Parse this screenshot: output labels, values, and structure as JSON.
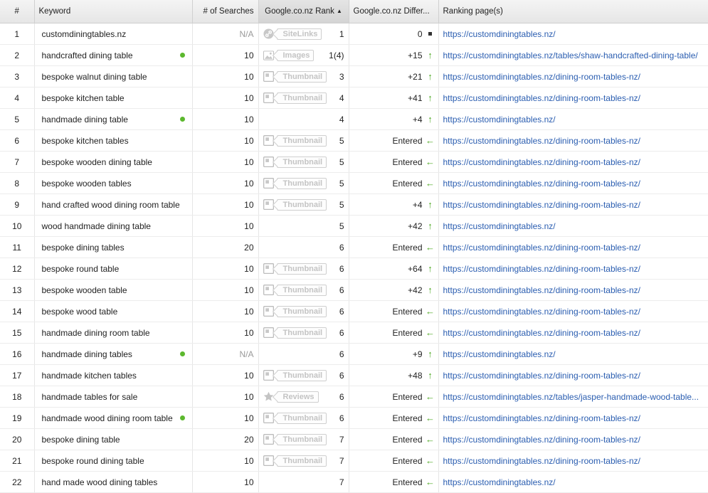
{
  "colors": {
    "accent_green": "#5cb82e",
    "link_blue": "#2a5db0",
    "tag_gray": "#c4c4c4"
  },
  "icons": {
    "sitelinks": "link-icon",
    "images": "image-icon",
    "thumbnail": "thumbnail-icon",
    "reviews": "star-icon",
    "up": "arrow-up-icon",
    "same": "no-change-icon",
    "entered": "arrow-left-icon",
    "sort": "sort-asc-icon"
  },
  "header": {
    "num": "#",
    "keyword": "Keyword",
    "searches": "# of Searches",
    "rank": "Google.co.nz Rank",
    "diff": "Google.co.nz Differ...",
    "page": "Ranking page(s)"
  },
  "rows": [
    {
      "num": "1",
      "keyword": "customdiningtables.nz",
      "dot": false,
      "searches": "N/A",
      "feature": "sitelinks",
      "feature_label": "SiteLinks",
      "rank": "1",
      "diff": "0",
      "diff_type": "same",
      "url": "https://customdiningtables.nz/"
    },
    {
      "num": "2",
      "keyword": "handcrafted dining table",
      "dot": true,
      "searches": "10",
      "feature": "images",
      "feature_label": "Images",
      "rank": "1(4)",
      "diff": "+15",
      "diff_type": "up",
      "url": "https://customdiningtables.nz/tables/shaw-handcrafted-dining-table/"
    },
    {
      "num": "3",
      "keyword": "bespoke walnut dining table",
      "dot": false,
      "searches": "10",
      "feature": "thumbnail",
      "feature_label": "Thumbnail",
      "rank": "3",
      "diff": "+21",
      "diff_type": "up",
      "url": "https://customdiningtables.nz/dining-room-tables-nz/"
    },
    {
      "num": "4",
      "keyword": "bespoke kitchen table",
      "dot": false,
      "searches": "10",
      "feature": "thumbnail",
      "feature_label": "Thumbnail",
      "rank": "4",
      "diff": "+41",
      "diff_type": "up",
      "url": "https://customdiningtables.nz/dining-room-tables-nz/"
    },
    {
      "num": "5",
      "keyword": "handmade dining table",
      "dot": true,
      "searches": "10",
      "feature": "",
      "feature_label": "",
      "rank": "4",
      "diff": "+4",
      "diff_type": "up",
      "url": "https://customdiningtables.nz/"
    },
    {
      "num": "6",
      "keyword": "bespoke kitchen tables",
      "dot": false,
      "searches": "10",
      "feature": "thumbnail",
      "feature_label": "Thumbnail",
      "rank": "5",
      "diff": "Entered",
      "diff_type": "entered",
      "url": "https://customdiningtables.nz/dining-room-tables-nz/"
    },
    {
      "num": "7",
      "keyword": "bespoke wooden dining table",
      "dot": false,
      "searches": "10",
      "feature": "thumbnail",
      "feature_label": "Thumbnail",
      "rank": "5",
      "diff": "Entered",
      "diff_type": "entered",
      "url": "https://customdiningtables.nz/dining-room-tables-nz/"
    },
    {
      "num": "8",
      "keyword": "bespoke wooden tables",
      "dot": false,
      "searches": "10",
      "feature": "thumbnail",
      "feature_label": "Thumbnail",
      "rank": "5",
      "diff": "Entered",
      "diff_type": "entered",
      "url": "https://customdiningtables.nz/dining-room-tables-nz/"
    },
    {
      "num": "9",
      "keyword": "hand crafted wood dining room table",
      "dot": false,
      "searches": "10",
      "feature": "thumbnail",
      "feature_label": "Thumbnail",
      "rank": "5",
      "diff": "+4",
      "diff_type": "up",
      "url": "https://customdiningtables.nz/dining-room-tables-nz/"
    },
    {
      "num": "10",
      "keyword": "wood handmade dining table",
      "dot": false,
      "searches": "10",
      "feature": "",
      "feature_label": "",
      "rank": "5",
      "diff": "+42",
      "diff_type": "up",
      "url": "https://customdiningtables.nz/"
    },
    {
      "num": "11",
      "keyword": "bespoke dining tables",
      "dot": false,
      "searches": "20",
      "feature": "",
      "feature_label": "",
      "rank": "6",
      "diff": "Entered",
      "diff_type": "entered",
      "url": "https://customdiningtables.nz/dining-room-tables-nz/"
    },
    {
      "num": "12",
      "keyword": "bespoke round table",
      "dot": false,
      "searches": "10",
      "feature": "thumbnail",
      "feature_label": "Thumbnail",
      "rank": "6",
      "diff": "+64",
      "diff_type": "up",
      "url": "https://customdiningtables.nz/dining-room-tables-nz/"
    },
    {
      "num": "13",
      "keyword": "bespoke wooden table",
      "dot": false,
      "searches": "10",
      "feature": "thumbnail",
      "feature_label": "Thumbnail",
      "rank": "6",
      "diff": "+42",
      "diff_type": "up",
      "url": "https://customdiningtables.nz/dining-room-tables-nz/"
    },
    {
      "num": "14",
      "keyword": "bespoke wood table",
      "dot": false,
      "searches": "10",
      "feature": "thumbnail",
      "feature_label": "Thumbnail",
      "rank": "6",
      "diff": "Entered",
      "diff_type": "entered",
      "url": "https://customdiningtables.nz/dining-room-tables-nz/"
    },
    {
      "num": "15",
      "keyword": "handmade dining room table",
      "dot": false,
      "searches": "10",
      "feature": "thumbnail",
      "feature_label": "Thumbnail",
      "rank": "6",
      "diff": "Entered",
      "diff_type": "entered",
      "url": "https://customdiningtables.nz/dining-room-tables-nz/"
    },
    {
      "num": "16",
      "keyword": "handmade dining tables",
      "dot": true,
      "searches": "N/A",
      "feature": "",
      "feature_label": "",
      "rank": "6",
      "diff": "+9",
      "diff_type": "up",
      "url": "https://customdiningtables.nz/"
    },
    {
      "num": "17",
      "keyword": "handmade kitchen tables",
      "dot": false,
      "searches": "10",
      "feature": "thumbnail",
      "feature_label": "Thumbnail",
      "rank": "6",
      "diff": "+48",
      "diff_type": "up",
      "url": "https://customdiningtables.nz/dining-room-tables-nz/"
    },
    {
      "num": "18",
      "keyword": "handmade tables for sale",
      "dot": false,
      "searches": "10",
      "feature": "reviews",
      "feature_label": "Reviews",
      "rank": "6",
      "diff": "Entered",
      "diff_type": "entered",
      "url": "https://customdiningtables.nz/tables/jasper-handmade-wood-table..."
    },
    {
      "num": "19",
      "keyword": "handmade wood dining room table",
      "dot": true,
      "searches": "10",
      "feature": "thumbnail",
      "feature_label": "Thumbnail",
      "rank": "6",
      "diff": "Entered",
      "diff_type": "entered",
      "url": "https://customdiningtables.nz/dining-room-tables-nz/"
    },
    {
      "num": "20",
      "keyword": "bespoke dining table",
      "dot": false,
      "searches": "20",
      "feature": "thumbnail",
      "feature_label": "Thumbnail",
      "rank": "7",
      "diff": "Entered",
      "diff_type": "entered",
      "url": "https://customdiningtables.nz/dining-room-tables-nz/"
    },
    {
      "num": "21",
      "keyword": "bespoke round dining table",
      "dot": false,
      "searches": "10",
      "feature": "thumbnail",
      "feature_label": "Thumbnail",
      "rank": "7",
      "diff": "Entered",
      "diff_type": "entered",
      "url": "https://customdiningtables.nz/dining-room-tables-nz/"
    },
    {
      "num": "22",
      "keyword": "hand made wood dining tables",
      "dot": false,
      "searches": "10",
      "feature": "",
      "feature_label": "",
      "rank": "7",
      "diff": "Entered",
      "diff_type": "entered",
      "url": "https://customdiningtables.nz/"
    }
  ]
}
